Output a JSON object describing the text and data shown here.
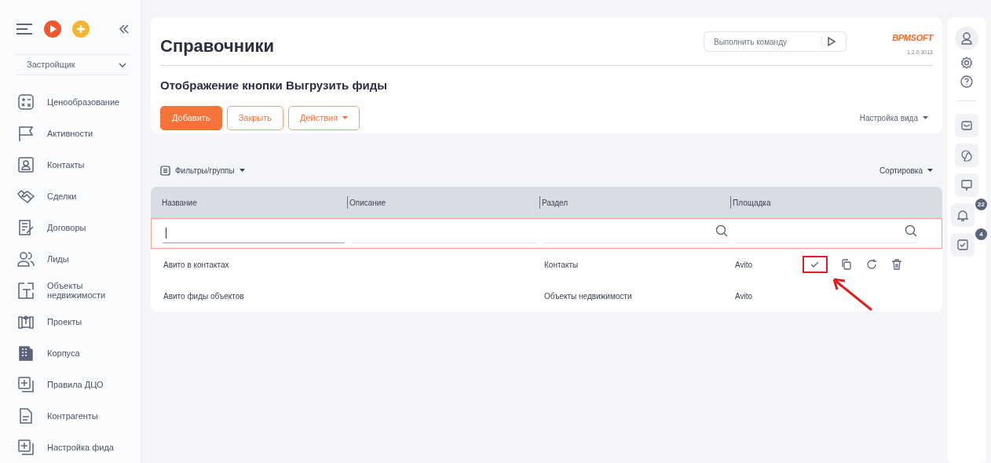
{
  "sidebar": {
    "workspace": "Застройщик",
    "items": [
      {
        "label": "Ценообразование"
      },
      {
        "label": "Активности"
      },
      {
        "label": "Контакты"
      },
      {
        "label": "Сделки"
      },
      {
        "label": "Договоры"
      },
      {
        "label": "Лиды"
      },
      {
        "label": "Объекты недвижимости"
      },
      {
        "label": "Проекты"
      },
      {
        "label": "Корпуса"
      },
      {
        "label": "Правила ДЦО"
      },
      {
        "label": "Контрагенты"
      },
      {
        "label": "Настройка фида"
      }
    ]
  },
  "header": {
    "title": "Справочники",
    "command_placeholder": "Выполнить команду",
    "logo": "BPMSOFT",
    "version": "1.2.0.3013"
  },
  "page": {
    "subtitle": "Отображение кнопки Выгрузить фиды",
    "buttons": [
      {
        "label": "Добавить",
        "kind": "primary"
      },
      {
        "label": "Закрыть",
        "kind": "outline"
      },
      {
        "label": "Действия",
        "kind": "dropdown"
      }
    ],
    "view_settings": "Настройка вида",
    "filters": "Фильтры/группы",
    "sorting": "Сортировка"
  },
  "table": {
    "columns": [
      "Название",
      "Описание",
      "Раздел",
      "Площадка"
    ],
    "rows": [
      {
        "cells": [
          "Авито в контактах",
          "",
          "Контакты",
          "Avito"
        ],
        "actions_visible": true
      },
      {
        "cells": [
          "Авито фиды объектов",
          "",
          "Объекты недвижимости",
          "Avito"
        ],
        "actions_visible": false
      }
    ]
  },
  "right_rail": {
    "notifications_badge": "22",
    "tasks_badge": "4"
  }
}
